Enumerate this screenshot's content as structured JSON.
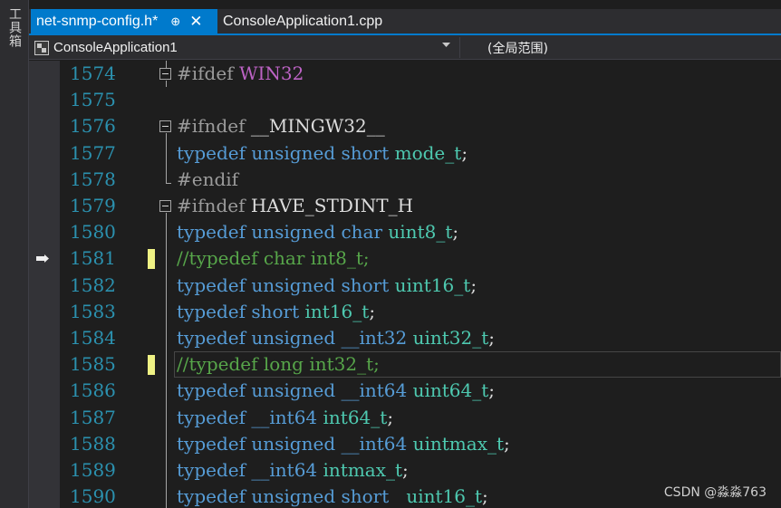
{
  "toolbox": {
    "label": "工具箱"
  },
  "tabs": [
    {
      "label": "net-snmp-config.h*",
      "active": true,
      "pin_glyph": "⊕",
      "close_glyph": "✕"
    },
    {
      "label": "ConsoleApplication1.cpp",
      "active": false
    }
  ],
  "nav": {
    "project": "ConsoleApplication1",
    "scope": "(全局范围)"
  },
  "lines": [
    {
      "n": "1574",
      "tokens": [
        [
          "pp",
          "#ifdef "
        ],
        [
          "mac",
          "WIN32"
        ]
      ]
    },
    {
      "n": "1575",
      "tokens": []
    },
    {
      "n": "1576",
      "tokens": [
        [
          "pp",
          "#ifndef "
        ],
        [
          "id",
          "__MINGW32__"
        ]
      ]
    },
    {
      "n": "1577",
      "tokens": [
        [
          "kw",
          "typedef unsigned short "
        ],
        [
          "ty",
          "mode_t"
        ],
        [
          "id",
          ";"
        ]
      ]
    },
    {
      "n": "1578",
      "tokens": [
        [
          "pp",
          "#endif"
        ]
      ]
    },
    {
      "n": "1579",
      "tokens": [
        [
          "pp",
          "#ifndef "
        ],
        [
          "id",
          "HAVE_STDINT_H"
        ]
      ]
    },
    {
      "n": "1580",
      "tokens": [
        [
          "kw",
          "typedef unsigned char "
        ],
        [
          "ty",
          "uint8_t"
        ],
        [
          "id",
          ";"
        ]
      ]
    },
    {
      "n": "1581",
      "tokens": [
        [
          "cm",
          "//typedef char int8_t;"
        ]
      ]
    },
    {
      "n": "1582",
      "tokens": [
        [
          "kw",
          "typedef unsigned short "
        ],
        [
          "ty",
          "uint16_t"
        ],
        [
          "id",
          ";"
        ]
      ]
    },
    {
      "n": "1583",
      "tokens": [
        [
          "kw",
          "typedef short "
        ],
        [
          "ty",
          "int16_t"
        ],
        [
          "id",
          ";"
        ]
      ]
    },
    {
      "n": "1584",
      "tokens": [
        [
          "kw",
          "typedef unsigned __int32 "
        ],
        [
          "ty",
          "uint32_t"
        ],
        [
          "id",
          ";"
        ]
      ]
    },
    {
      "n": "1585",
      "tokens": [
        [
          "cm",
          "//typedef long int32_t;"
        ]
      ]
    },
    {
      "n": "1586",
      "tokens": [
        [
          "kw",
          "typedef unsigned __int64 "
        ],
        [
          "ty",
          "uint64_t"
        ],
        [
          "id",
          ";"
        ]
      ]
    },
    {
      "n": "1587",
      "tokens": [
        [
          "kw",
          "typedef __int64 "
        ],
        [
          "ty",
          "int64_t"
        ],
        [
          "id",
          ";"
        ]
      ]
    },
    {
      "n": "1588",
      "tokens": [
        [
          "kw",
          "typedef unsigned __int64 "
        ],
        [
          "ty",
          "uintmax_t"
        ],
        [
          "id",
          ";"
        ]
      ]
    },
    {
      "n": "1589",
      "tokens": [
        [
          "kw",
          "typedef __int64 "
        ],
        [
          "ty",
          "intmax_t"
        ],
        [
          "id",
          ";"
        ]
      ]
    },
    {
      "n": "1590",
      "tokens": [
        [
          "kw",
          "typedef unsigned short   "
        ],
        [
          "ty",
          "uint16_t"
        ],
        [
          "id",
          ";"
        ]
      ]
    }
  ],
  "watermark": "CSDN @淼淼763",
  "colors": {
    "accent": "#007acc",
    "keyword": "#569cd6",
    "type": "#4ec9b0",
    "preprocessor": "#9b9b9b",
    "macro": "#bd63c5",
    "comment": "#57a64a",
    "line_number": "#2b91af",
    "change_marker": "#eff284"
  }
}
